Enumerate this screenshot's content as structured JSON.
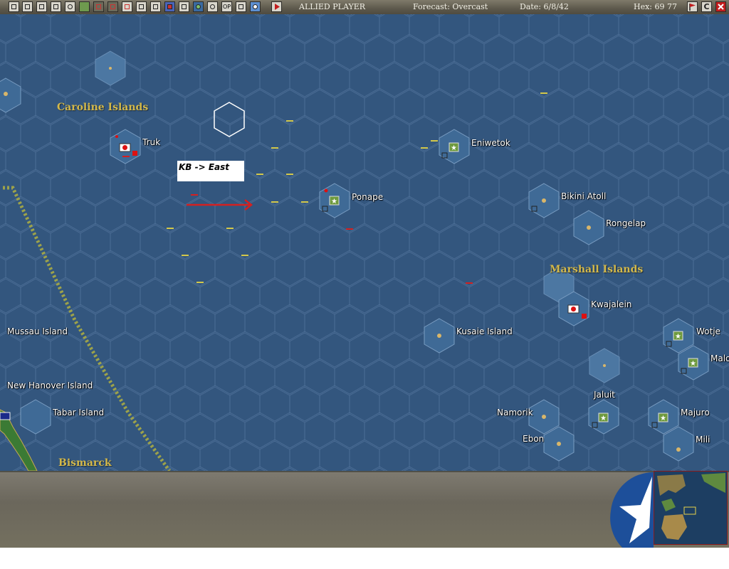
{
  "toolbar": {
    "side": "ALLIED PLAYER",
    "forecast": "Forecast: Overcast",
    "date": "Date: 6/8/42",
    "hex": "Hex: 69 77",
    "quit_label": "C"
  },
  "map": {
    "regions": {
      "caroline": "Caroline Islands",
      "marshall": "Marshall Islands",
      "bismarck": "Bismarck"
    },
    "bases": {
      "truk": "Truk",
      "eniwetok": "Eniwetok",
      "ponape": "Ponape",
      "bikini": "Bikini Atoll",
      "rongelap": "Rongelap",
      "kwajalein": "Kwajalein",
      "kusaie": "Kusaie Island",
      "wotje": "Wotje",
      "malo": "Malo",
      "jaluit": "Jaluit",
      "namorik": "Namorik",
      "majuro": "Majuro",
      "ebon": "Ebon",
      "mili": "Mili",
      "mussau": "Mussau Island",
      "new_hanover": "New Hanover Island",
      "tabar": "Tabar Island"
    },
    "annotation": "KB -> East"
  },
  "colors": {
    "ocean": "#33567e",
    "hex_line": "#4b6d95",
    "label_gold": "#d3b84a",
    "arrow_red": "#d42020",
    "dotted_line": "#9da24a"
  }
}
